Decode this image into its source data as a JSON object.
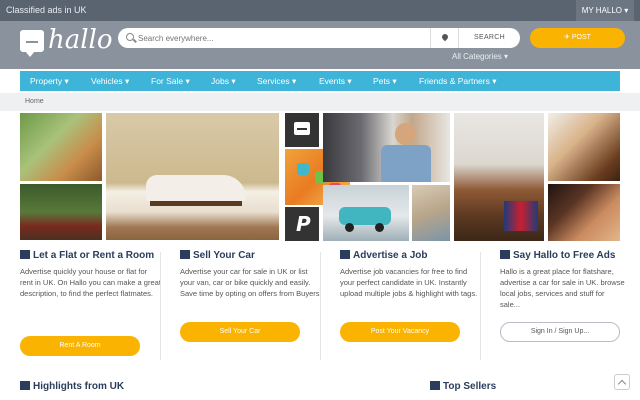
{
  "topbar": {
    "tagline": "Classified ads in UK",
    "account": "MY HALLO ▾"
  },
  "header": {
    "logo_text": "hallo",
    "search_placeholder": "Search everywhere...",
    "search_button": "SEARCH",
    "all_categories": "All Categories ▾",
    "post_button": "✈ POST"
  },
  "nav": {
    "items": [
      {
        "label": "Property ▾"
      },
      {
        "label": "Vehicles ▾"
      },
      {
        "label": "For Sale ▾"
      },
      {
        "label": "Jobs ▾"
      },
      {
        "label": "Services ▾"
      },
      {
        "label": "Events ▾"
      },
      {
        "label": "Pets ▾"
      },
      {
        "label": "Friends & Partners ▾"
      }
    ]
  },
  "breadcrumb": {
    "home": "Home"
  },
  "columns": [
    {
      "title": "Let a Flat or Rent a Room",
      "body": "Advertise quickly your house or flat for rent in UK. On Hallo you can make a great description, to find the perfect flatmates.",
      "button": "Rent A Room",
      "icon": "home-icon"
    },
    {
      "title": "Sell Your Car",
      "body": "Advertise your car for sale in UK or list your van, car or bike quickly and easily. Save time by opting on offers from Buyers.",
      "button": "Sell Your Car",
      "icon": "car-icon"
    },
    {
      "title": "Advertise a Job",
      "body": "Advertise job vacancies for free to find your perfect candidate in UK. Instantly upload multiple jobs & highlight with tags.",
      "button": "Post Your Vacancy",
      "icon": "briefcase-icon"
    },
    {
      "title": "Say Hallo to Free Ads",
      "body": "Hallo is a great place for flatshare, advertise a car for sale in UK. browse local jobs, services and stuff for sale...",
      "button": "Sign In / Sign Up...",
      "icon": "send-icon"
    }
  ],
  "sections": {
    "highlights": "Highlights from UK",
    "top_sellers": "Top Sellers"
  },
  "colors": {
    "accent_yellow": "#f9b300",
    "nav_blue": "#3db4d8",
    "header_gray": "#8a939d",
    "title_navy": "#2a3d5c"
  }
}
